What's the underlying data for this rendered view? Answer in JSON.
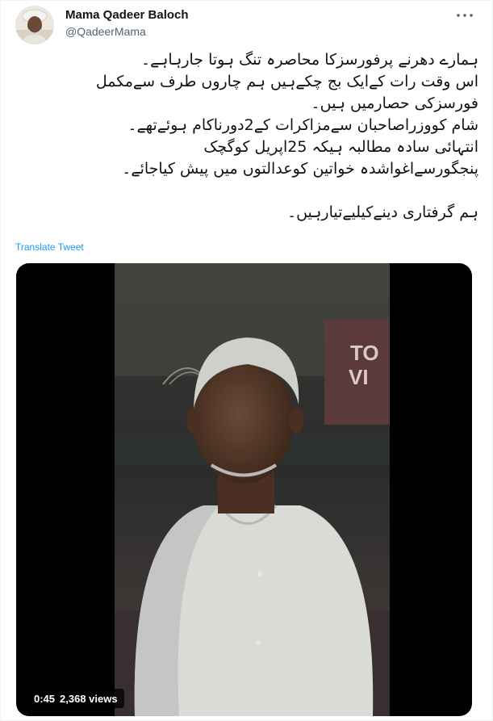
{
  "author": {
    "display_name": "Mama Qadeer Baloch",
    "handle": "@QadeerMama"
  },
  "tweet": {
    "lines": [
      "ہمارے دھرنے پرفورسزکا محاصرہ تنگ ہوتا جارہاہے۔",
      "اس وقت رات کےایک بج چکےہیں ہم چاروں طرف سےمکمل",
      "فورسزکی حصارمیں ہیں۔",
      "شام کووزراصاحبان سےمزاکرات کے2دورناکام ہوئےتھے۔",
      "انتہائی سادہ مطالبہ ہیکہ 25اپریل کوگچک",
      "پنجگورسےاغواشدہ خواتین کوعدالتوں میں پیش کیاجائے۔",
      "",
      "ہم گرفتاری دینےکیلیےتیارہیں۔"
    ],
    "translate_label": "Translate Tweet"
  },
  "video": {
    "duration": "0:45",
    "views": "2,368 views"
  },
  "icons": {
    "more": "more-horizontal-icon"
  },
  "colors": {
    "link": "#1d9bf0",
    "secondary_text": "#536471",
    "primary_text": "#0f1419"
  }
}
